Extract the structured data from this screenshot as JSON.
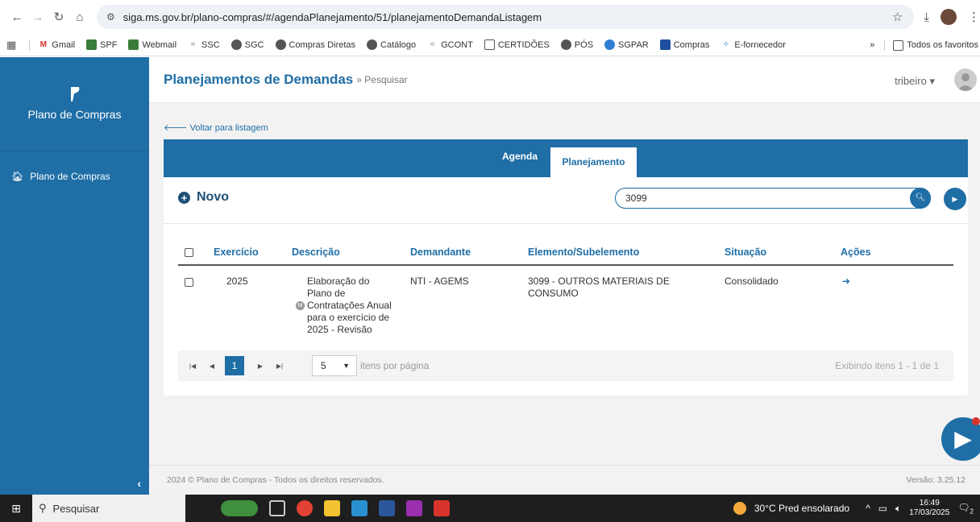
{
  "browser": {
    "url": "siga.ms.gov.br/plano-compras/#/agendaPlanejamento/51/planejamentoDemandaListagem",
    "bookmarks": [
      "Gmail",
      "SPF",
      "Webmail",
      "SSC",
      "SGC",
      "Compras Diretas",
      "Catálogo",
      "GCONT",
      "CERTIDÕES",
      "PÓS",
      "SGPAR",
      "Compras",
      "E-fornecedor"
    ],
    "bookmarks_more": "»",
    "all_favorites": "Todos os favoritos"
  },
  "sidebar": {
    "brand": "Plano de Compras",
    "menu_item": "Plano de Compras"
  },
  "header": {
    "title": "Planejamentos de Demandas",
    "subtitle": "» Pesquisar",
    "user": "tribeiro"
  },
  "back_link": "Voltar para listagem",
  "tabs": [
    "Agenda",
    "Planejamento"
  ],
  "toolbar": {
    "novo_label": "Novo",
    "search_value": "3099"
  },
  "table": {
    "columns": [
      "Exercício",
      "Descrição",
      "Demandante",
      "Elemento/Subelemento",
      "Situação",
      "Ações"
    ],
    "rows": [
      {
        "exercicio": "2025",
        "descricao_lines": [
          "Elaboração do",
          "Plano de",
          "Contratações Anual",
          "para o exercício de",
          "2025 - Revisão"
        ],
        "badge": "M",
        "demandante": "NTI - AGEMS",
        "elemento_lines": [
          "3099 - OUTROS MATERIAIS DE",
          "CONSUMO"
        ],
        "situacao": "Consolidado"
      }
    ]
  },
  "pager": {
    "current_page": "1",
    "page_size": "5",
    "per_page_label": "itens por página",
    "showing": "Exibindo itens 1 - 1 de 1"
  },
  "footer": {
    "copyright": "2024 © Plano de Compras - Todos os direitos reservados.",
    "version": "Versão: 3.25.12"
  },
  "taskbar": {
    "search_placeholder": "Pesquisar",
    "weather": "30°C  Pred ensolarado",
    "time": "16:49",
    "date": "17/03/2025",
    "notifications": "2"
  },
  "colors": {
    "primary": "#1f6ea6",
    "title_dark": "#1f4f74"
  }
}
